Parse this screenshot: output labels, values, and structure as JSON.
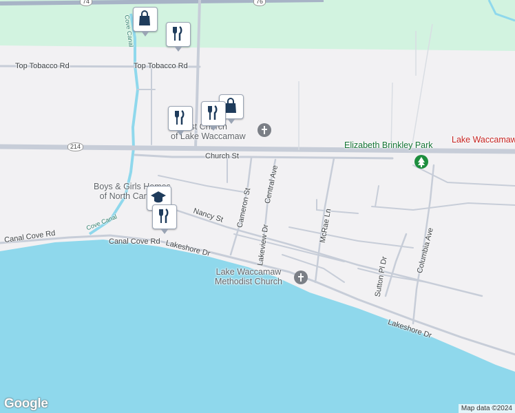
{
  "map": {
    "roads": {
      "top_tobacco_left": "Top Tobacco Rd",
      "top_tobacco_right": "Top Tobacco Rd",
      "church_st": "Church St",
      "nancy_st": "Nancy St",
      "canal_cove_left": "Canal Cove Rd",
      "canal_cove_right": "Canal Cove Rd",
      "lakeshore_left": "Lakeshore Dr",
      "lakeshore_right": "Lakeshore Dr",
      "cameron_st": "Cameron St",
      "central_ave": "Central Ave",
      "lakeview_dr": "Lakeview Dr",
      "mcrae_ln": "McRae Ln",
      "sutton_pl_dr": "Sutton Pl Dr",
      "columbia_ave": "Columbia Ave"
    },
    "shields": {
      "us74": "74",
      "us76": "76",
      "nc214": "214"
    },
    "waterways": {
      "cove_canal_upper": "Cove Canal",
      "cove_canal_lower": "Cove Canal"
    },
    "pois": {
      "baptist_church": "Baptist Church\nof Lake Waccamaw",
      "boys_girls_homes": "Boys & Girls Homes\nof North Carolina",
      "methodist_church": "Lake Waccamaw\nMethodist Church",
      "park": "Elizabeth Brinkley Park",
      "place_red": "Lake Waccamaw"
    },
    "icons": [
      "shopping-bag-icon",
      "restaurant-icon",
      "church-icon",
      "park-tree-icon",
      "school-icon"
    ],
    "colors": {
      "water": "#8fd8ec",
      "park_green": "#d2f3e0",
      "road": "#c7cdd8",
      "land": "#f2f1f3",
      "pin_icon": "#1f3c5c"
    }
  },
  "branding": {
    "logo": "Google",
    "attribution": "Map data ©2024"
  }
}
